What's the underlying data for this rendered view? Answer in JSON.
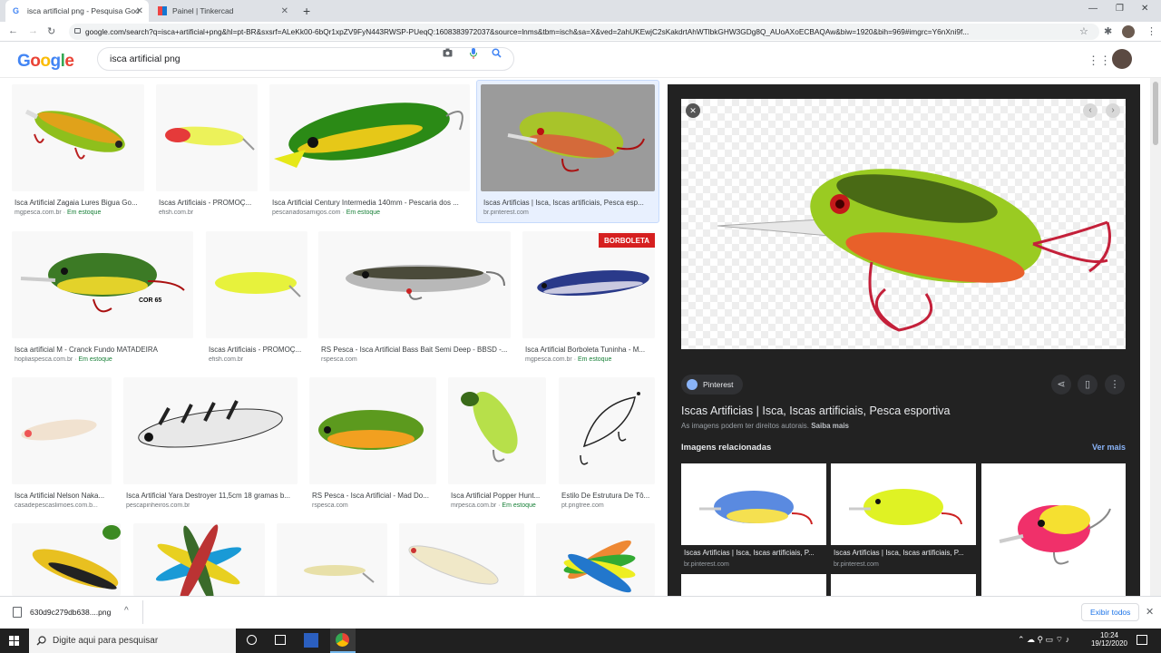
{
  "tabs": [
    {
      "label": "isca artificial png - Pesquisa Goo"
    },
    {
      "label": "Painel | Tinkercad"
    }
  ],
  "address": "google.com/search?q=isca+artificial+png&hl=pt-BR&sxsrf=ALeKk00-6bQr1xpZV9FyN443RWSP-PUeqQ:1608383972037&source=lnms&tbm=isch&sa=X&ved=2ahUKEwjC2sKakdrtAhWTlbkGHW3GDg8Q_AUoAXoECBAQAw&biw=1920&bih=969#imgrc=Y6nXni9f...",
  "google": {
    "logo": "Google",
    "query": "isca artificial png"
  },
  "results": [
    {
      "caption": "Isca Artificial Zagaia Lures Bigua Go...",
      "source": "mgpesca.com.br",
      "stock": "Em estoque"
    },
    {
      "caption": "Iscas Artificiais - PROMOÇ...",
      "source": "efish.com.br",
      "stock": ""
    },
    {
      "caption": "Isca Artificial Century Intermedia 140mm - Pescaria dos ...",
      "source": "pescariadosamigos.com",
      "stock": "Em estoque"
    },
    {
      "caption": "Iscas Artificias | Isca, Iscas artificiais, Pesca esp...",
      "source": "br.pinterest.com",
      "stock": ""
    },
    {
      "caption": "Isca artificial M - Cranck Fundo MATADEIRA",
      "source": "hopliaspesca.com.br",
      "stock": "Em estoque"
    },
    {
      "caption": "Iscas Artificiais - PROMOÇ...",
      "source": "efish.com.br",
      "stock": ""
    },
    {
      "caption": "RS Pesca - Isca Artificial Bass Bait Semi Deep - BBSD -...",
      "source": "rspesca.com",
      "stock": ""
    },
    {
      "caption": "Isca Artificial Borboleta Tuninha - M...",
      "source": "mgpesca.com.br",
      "stock": "Em estoque"
    },
    {
      "caption": "Isca Artificial Nelson Naka...",
      "source": "casadepescaslimoes.com.b...",
      "stock": ""
    },
    {
      "caption": "Isca Artificial Yara Destroyer 11,5cm 18 gramas b...",
      "source": "pescapinheiros.com.br",
      "stock": ""
    },
    {
      "caption": "RS Pesca - Isca Artificial - Mad Do...",
      "source": "rspesca.com",
      "stock": ""
    },
    {
      "caption": "Isca Artificial Popper Hunt...",
      "source": "mrpesca.com.br",
      "stock": "Em estoque"
    },
    {
      "caption": "Estilo De Estrutura De Tô...",
      "source": "pt.pngtree.com",
      "stock": ""
    }
  ],
  "labels": {
    "cor65": "COR 65",
    "borboleta": "BORBOLETA"
  },
  "panel": {
    "site": "Pinterest",
    "title": "Iscas Artificias | Isca, Iscas artificiais, Pesca esportiva",
    "rights": "As imagens podem ter direitos autorais.",
    "learn": "Saiba mais",
    "related": "Imagens relacionadas",
    "more": "Ver mais",
    "rel": [
      {
        "caption": "Iscas Artificias | Isca, Iscas artificiais, P...",
        "source": "br.pinterest.com"
      },
      {
        "caption": "Iscas Artificias | Isca, Iscas artificiais, P...",
        "source": "br.pinterest.com"
      }
    ]
  },
  "download": {
    "file": "630d9c279db638....png",
    "showall": "Exibir todos"
  },
  "taskbar": {
    "search": "Digite aqui para pesquisar",
    "time": "10:24",
    "date": "19/12/2020"
  }
}
